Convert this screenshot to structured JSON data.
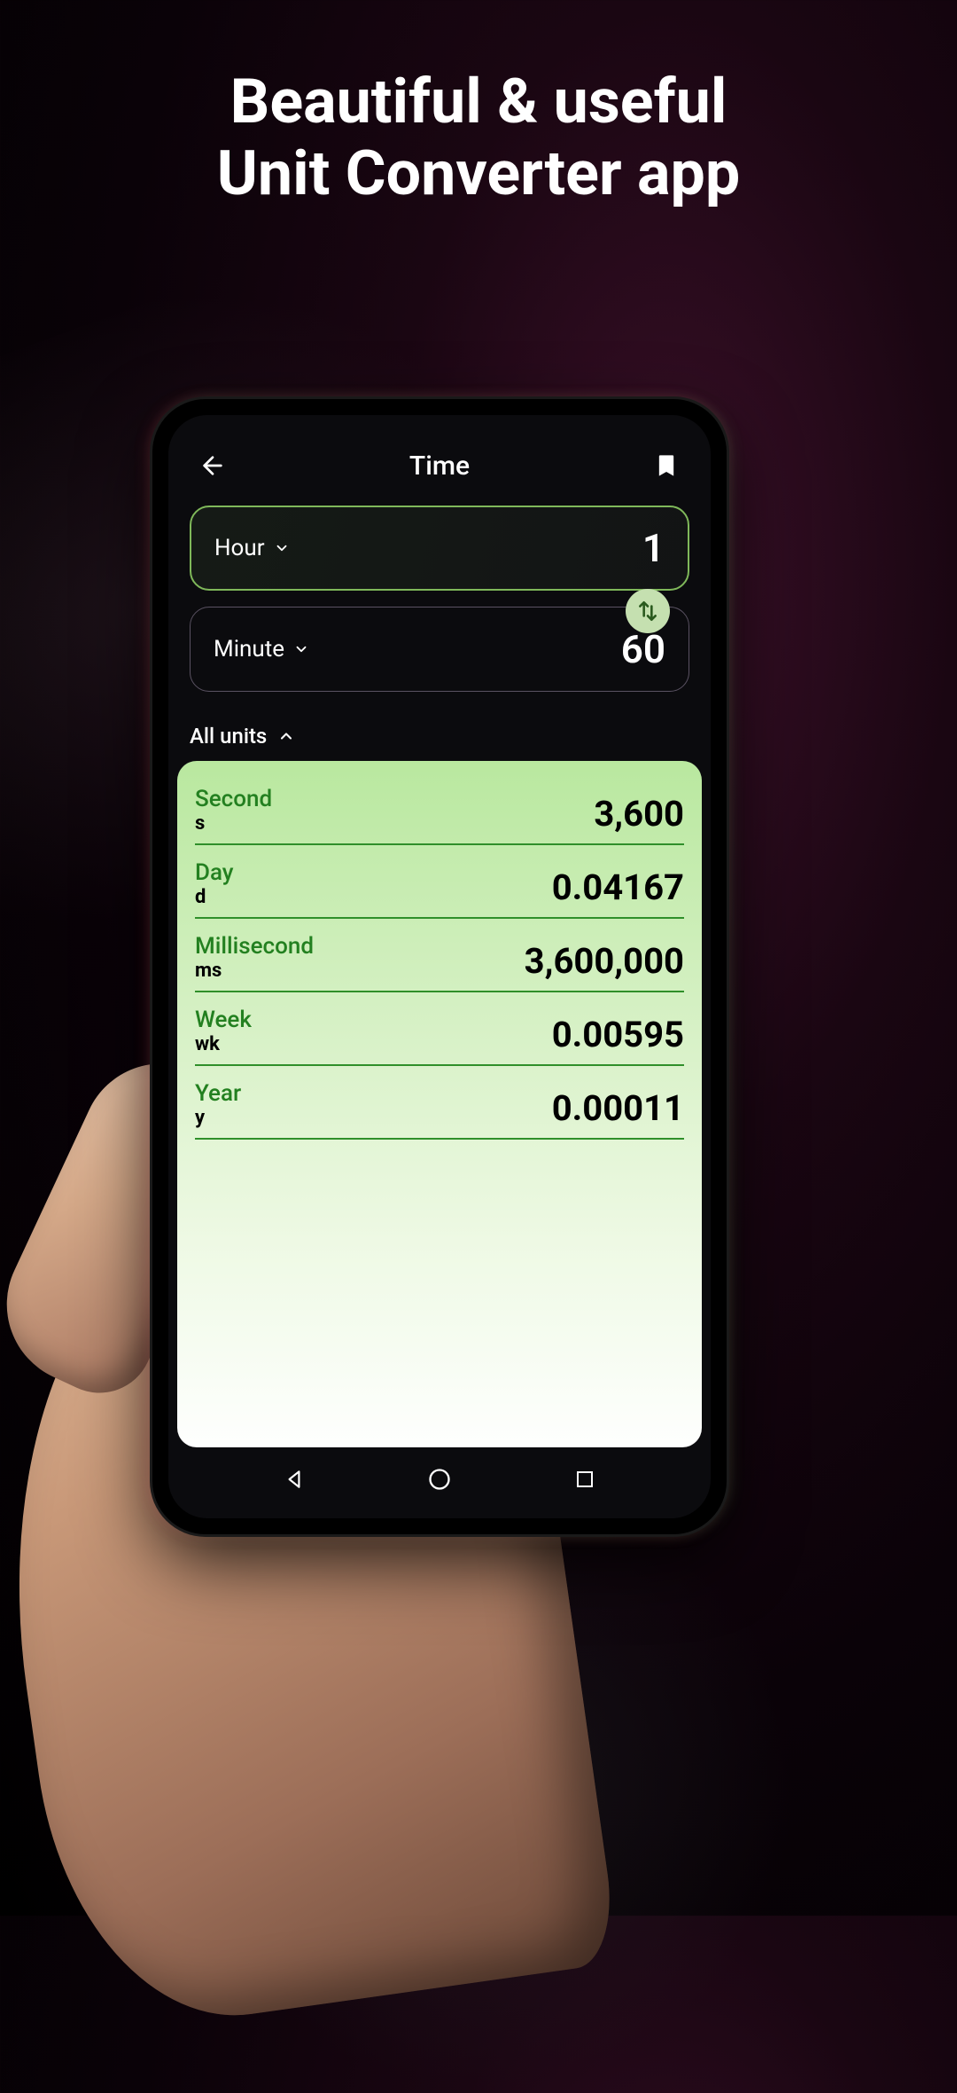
{
  "promo": {
    "line1": "Beautiful & useful",
    "line2": "Unit Converter app"
  },
  "header": {
    "title": "Time"
  },
  "from": {
    "unit": "Hour",
    "value": "1"
  },
  "to": {
    "unit": "Minute",
    "value": "60"
  },
  "allUnitsLabel": "All units",
  "units": [
    {
      "name": "Second",
      "abbr": "s",
      "value": "3,600"
    },
    {
      "name": "Day",
      "abbr": "d",
      "value": "0.04167"
    },
    {
      "name": "Millisecond",
      "abbr": "ms",
      "value": "3,600,000"
    },
    {
      "name": "Week",
      "abbr": "wk",
      "value": "0.00595"
    },
    {
      "name": "Year",
      "abbr": "y",
      "value": "0.00011"
    }
  ]
}
